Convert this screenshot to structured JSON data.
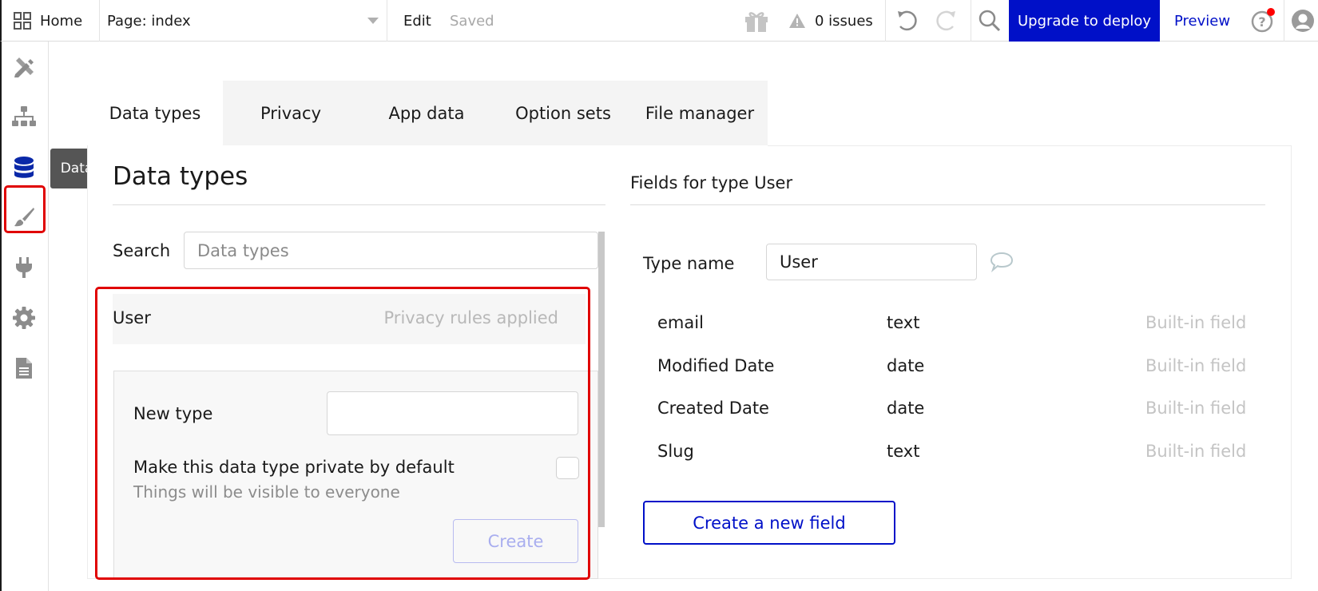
{
  "topbar": {
    "home_label": "Home",
    "home_icon": "grid-icon",
    "page_selector": "Page: index",
    "edit_label": "Edit",
    "saved_label": "Saved",
    "issues_label": "0 issues",
    "upgrade_label": "Upgrade to deploy",
    "preview_label": "Preview",
    "has_help_notification": true
  },
  "rail": {
    "items": [
      {
        "name": "design",
        "icon": "design-tools-icon"
      },
      {
        "name": "workflow",
        "icon": "sitemap-icon"
      },
      {
        "name": "data",
        "icon": "database-icon",
        "active": true
      },
      {
        "name": "styles",
        "icon": "paintbrush-icon"
      },
      {
        "name": "plugins",
        "icon": "plug-icon"
      },
      {
        "name": "settings",
        "icon": "gear-icon"
      },
      {
        "name": "logs",
        "icon": "document-icon"
      }
    ],
    "tooltip": "Data"
  },
  "tabs": [
    {
      "label": "Data types",
      "active": true
    },
    {
      "label": "Privacy"
    },
    {
      "label": "App data"
    },
    {
      "label": "Option sets"
    },
    {
      "label": "File manager"
    }
  ],
  "data_types": {
    "title": "Data types",
    "search_label": "Search",
    "search_placeholder": "Data types",
    "types": [
      {
        "name": "User",
        "status": "Privacy rules applied"
      }
    ],
    "new_type": {
      "label": "New type",
      "value": "",
      "private_label": "Make this data type private by default",
      "private_sub": "Things will be visible to everyone",
      "private_checked": false,
      "create_label": "Create"
    }
  },
  "fields": {
    "title": "Fields for type User",
    "type_name_label": "Type name",
    "type_name_value": "User",
    "rows": [
      {
        "name": "email",
        "type": "text",
        "kind": "Built-in field"
      },
      {
        "name": "Modified Date",
        "type": "date",
        "kind": "Built-in field"
      },
      {
        "name": "Created Date",
        "type": "date",
        "kind": "Built-in field"
      },
      {
        "name": "Slug",
        "type": "text",
        "kind": "Built-in field"
      }
    ],
    "create_field_label": "Create a new field"
  },
  "colors": {
    "accent": "#0010c8",
    "highlight": "#e00000",
    "notification": "#ff0000"
  }
}
